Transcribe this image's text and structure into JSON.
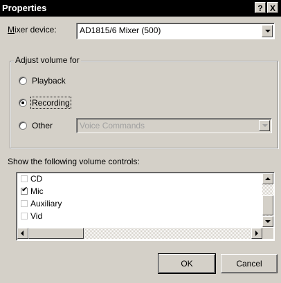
{
  "window": {
    "title": "Properties",
    "help_label": "?",
    "close_label": "X"
  },
  "mixer": {
    "label_accel": "M",
    "label_rest": "ixer device:",
    "value": "AD1815/6 Mixer (500)"
  },
  "adjust": {
    "group_title": "Adjust volume for",
    "options": [
      {
        "label": "Playback",
        "selected": false
      },
      {
        "label": "Recording",
        "selected": true
      },
      {
        "label": "Other",
        "selected": false
      }
    ],
    "other_value": "Voice Commands"
  },
  "controls": {
    "heading": "Show the following volume controls:",
    "items": [
      {
        "label": "CD",
        "checked": false
      },
      {
        "label": "Mic",
        "checked": true
      },
      {
        "label": "Auxiliary",
        "checked": false
      },
      {
        "label": "Vid",
        "checked": false
      }
    ]
  },
  "buttons": {
    "ok": "OK",
    "cancel": "Cancel"
  }
}
